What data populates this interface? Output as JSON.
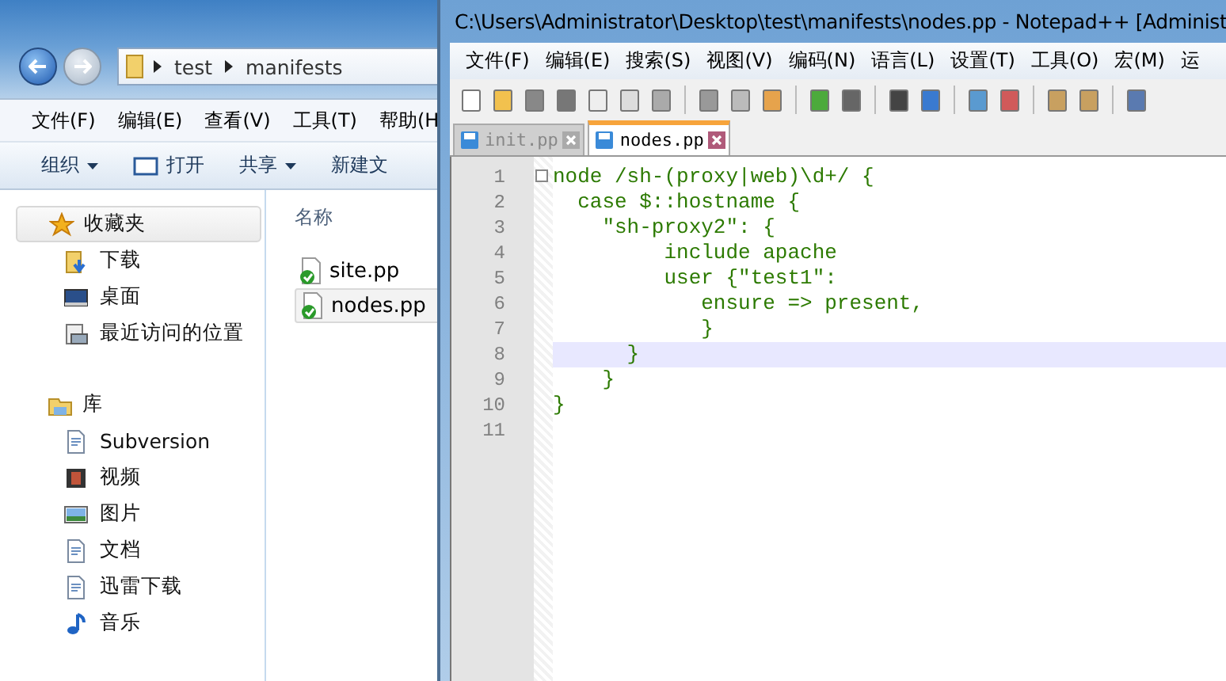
{
  "explorer": {
    "address": [
      "test",
      "manifests"
    ],
    "menu": [
      "文件(F)",
      "编辑(E)",
      "查看(V)",
      "工具(T)",
      "帮助(H"
    ],
    "toolbar": [
      {
        "label": "组织",
        "kind": "dropdown"
      },
      {
        "label": "打开",
        "kind": "open"
      },
      {
        "label": "共享",
        "kind": "dropdown"
      },
      {
        "label": "新建文",
        "kind": "plain"
      }
    ],
    "nav": [
      {
        "label": "收藏夹",
        "kind": "star",
        "selected": true,
        "children": [
          {
            "label": "下载",
            "kind": "download",
            "selected": false
          },
          {
            "label": "桌面",
            "kind": "desktop",
            "selected": false
          },
          {
            "label": "最近访问的位置",
            "kind": "recent",
            "selected": false
          }
        ]
      },
      {
        "label": "库",
        "kind": "library",
        "selected": false,
        "children": [
          {
            "label": "Subversion",
            "kind": "doc",
            "selected": false
          },
          {
            "label": "视频",
            "kind": "video",
            "selected": false
          },
          {
            "label": "图片",
            "kind": "picture",
            "selected": false
          },
          {
            "label": "文档",
            "kind": "doc",
            "selected": false
          },
          {
            "label": "迅雷下载",
            "kind": "doc",
            "selected": false
          },
          {
            "label": "音乐",
            "kind": "music",
            "selected": false
          }
        ]
      }
    ],
    "column_header": "名称",
    "files": [
      {
        "name": "site.pp",
        "selected": false
      },
      {
        "name": "nodes.pp",
        "selected": true
      }
    ]
  },
  "notepad": {
    "title": "C:\\Users\\Administrator\\Desktop\\test\\manifests\\nodes.pp - Notepad++ [Administ",
    "menu": [
      "文件(F)",
      "编辑(E)",
      "搜索(S)",
      "视图(V)",
      "编码(N)",
      "语言(L)",
      "设置(T)",
      "工具(O)",
      "宏(M)",
      "运"
    ],
    "tabs": [
      {
        "label": "init.pp",
        "selected": false
      },
      {
        "label": "nodes.pp",
        "selected": true
      }
    ],
    "lines": [
      {
        "number": "1",
        "text": "node /sh-(proxy|web)\\d+/ {",
        "current": false
      },
      {
        "number": "2",
        "text": "  case $::hostname {",
        "current": false
      },
      {
        "number": "3",
        "text": "    \"sh-proxy2\": {",
        "current": false
      },
      {
        "number": "4",
        "text": "         include apache",
        "current": false
      },
      {
        "number": "5",
        "text": "         user {\"test1\":",
        "current": false
      },
      {
        "number": "6",
        "text": "            ensure => present,",
        "current": false
      },
      {
        "number": "7",
        "text": "            }",
        "current": false
      },
      {
        "number": "8",
        "text": "      }",
        "current": true
      },
      {
        "number": "9",
        "text": "    }",
        "current": false
      },
      {
        "number": "10",
        "text": "}",
        "current": false
      },
      {
        "number": "11",
        "current": false
      }
    ]
  }
}
